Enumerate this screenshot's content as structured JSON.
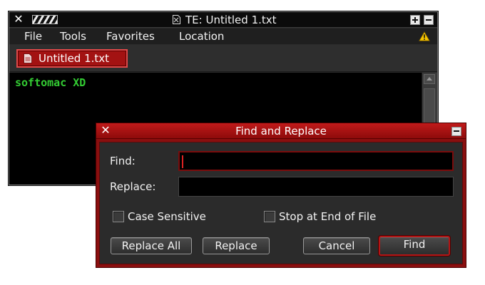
{
  "editor": {
    "title": "TE: Untitled 1.txt",
    "menu": [
      "File",
      "Tools",
      "Favorites",
      "Location"
    ],
    "tab_label": "Untitled 1.txt",
    "content": "softomac XD"
  },
  "dialog": {
    "title": "Find and Replace",
    "find_label": "Find:",
    "find_value": "",
    "replace_label": "Replace:",
    "replace_value": "",
    "case_sensitive_label": "Case Sensitive",
    "case_sensitive_checked": false,
    "stop_at_end_label": "Stop at End of File",
    "stop_at_end_checked": false,
    "buttons": {
      "replace_all": "Replace All",
      "replace": "Replace",
      "cancel": "Cancel",
      "find": "Find"
    }
  },
  "icons": {
    "close": "close-icon",
    "grip": "drag-grip-icon",
    "title_doc": "document-icon",
    "maximize": "plus-icon",
    "minimize": "minimize-icon",
    "warning": "warning-icon",
    "tab_doc": "document-icon"
  },
  "colors": {
    "accent_red": "#a31212",
    "editor_text": "#33cc33",
    "warning_yellow": "#f5c400"
  }
}
